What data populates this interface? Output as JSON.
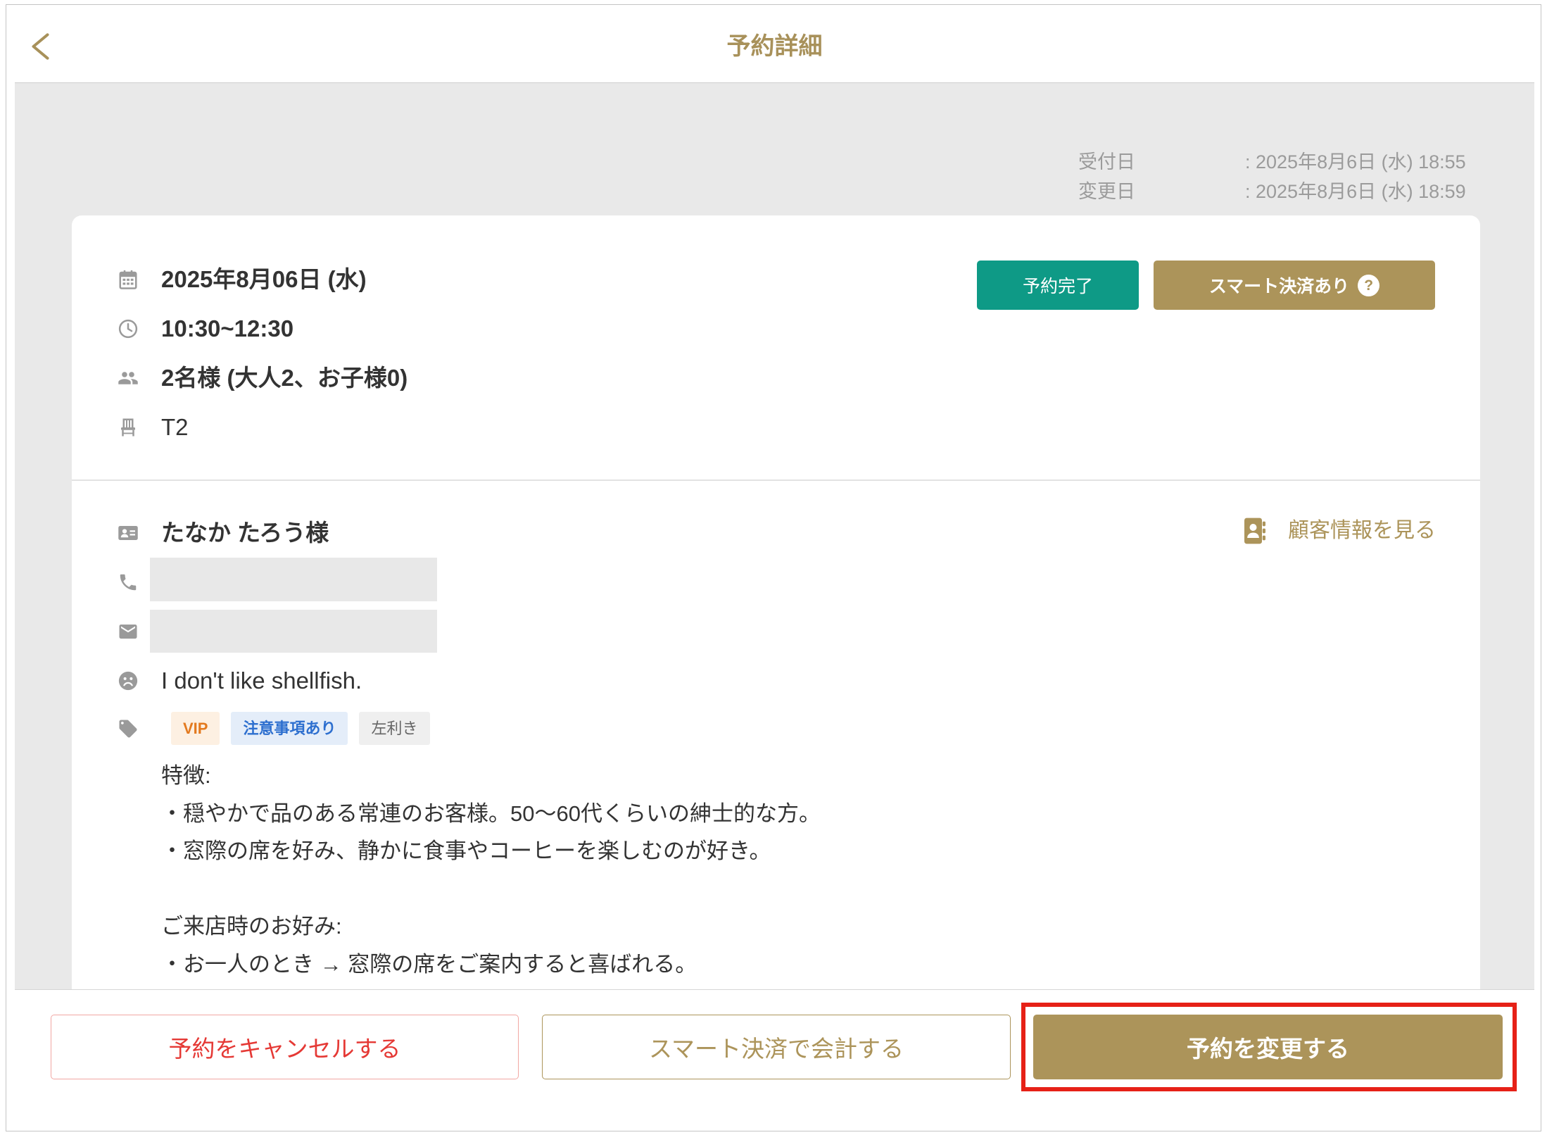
{
  "header": {
    "title": "予約詳細"
  },
  "meta": {
    "received": {
      "label": "受付日",
      "value": ": 2025年8月6日 (水) 18:55"
    },
    "modified": {
      "label": "変更日",
      "value": ": 2025年8月6日 (水) 18:59"
    }
  },
  "reservation": {
    "date": "2025年8月06日 (水)",
    "time": "10:30~12:30",
    "party": "2名様 (大人2、お子様0)",
    "table": "T2",
    "status": "予約完了",
    "smart_pay": "スマート決済あり",
    "smart_pay_help": "?"
  },
  "customer": {
    "name": "たなか たろう様",
    "view_link": "顧客情報を見る",
    "allergy": "I don't like shellfish.",
    "tags": [
      {
        "label": "VIP",
        "text_color": "#e37a1f",
        "bg_color": "#fdf0e2"
      },
      {
        "label": "注意事項あり",
        "text_color": "#2d6fcf",
        "bg_color": "#e4edf9"
      },
      {
        "label": "左利き",
        "text_color": "#666666",
        "bg_color": "#efefef"
      }
    ],
    "notes": [
      {
        "heading": "特徴:",
        "lines": [
          "・穏やかで品のある常連のお客様。50～60代くらいの紳士的な方。",
          "・窓際の席を好み、静かに食事やコーヒーを楽しむのが好き。"
        ]
      },
      {
        "heading": "ご来店時のお好み:",
        "lines": [
          "・お一人のとき → 窓際の席をご案内すると喜ばれる。"
        ]
      }
    ]
  },
  "footer": {
    "cancel": "予約をキャンセルする",
    "smart_pay_checkout": "スマート決済で会計する",
    "change": "予約を変更する"
  },
  "icons": {
    "back": "chevron-left-icon",
    "date": "calendar-icon",
    "time": "clock-icon",
    "party": "people-icon",
    "table": "chair-icon",
    "name": "id-card-icon",
    "phone": "phone-icon",
    "email": "envelope-icon",
    "allergy": "frown-icon",
    "tags": "tag-icon",
    "view_customer": "contact-book-icon"
  },
  "colors": {
    "accent": "#ac945a",
    "status": "#0e9a86",
    "danger": "#e53935",
    "highlight": "#e62117",
    "background": "#e9e9e9"
  }
}
